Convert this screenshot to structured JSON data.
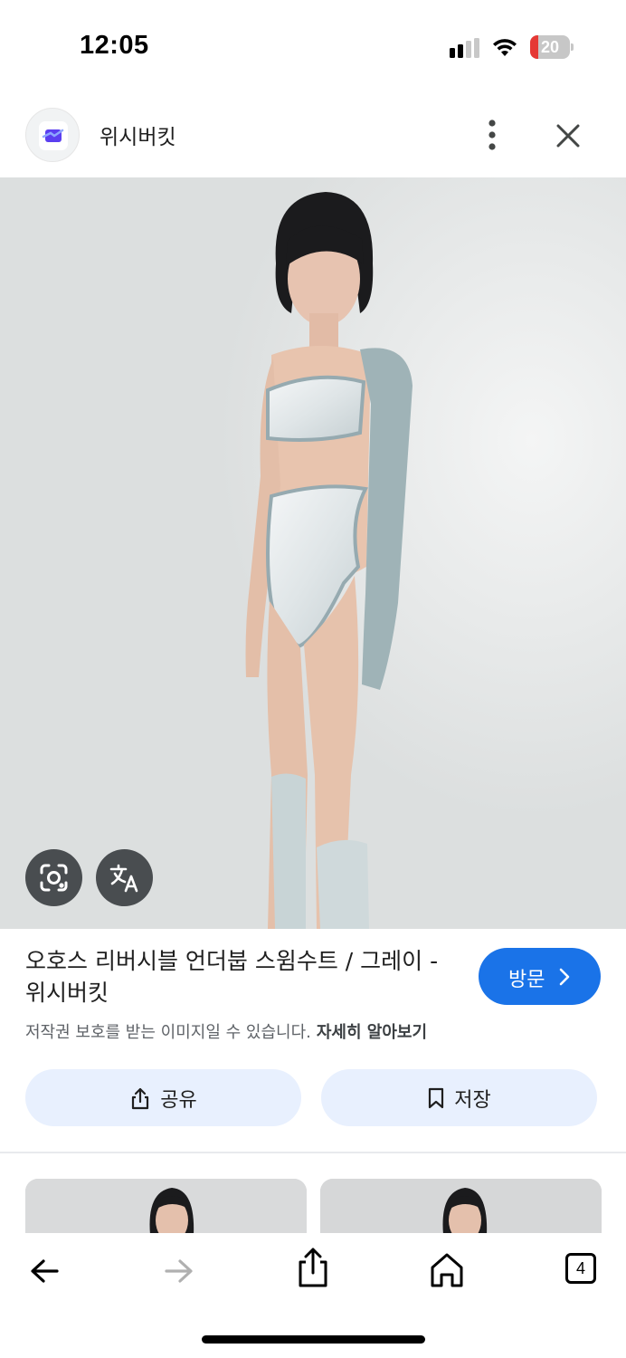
{
  "status_bar": {
    "time": "12:05",
    "battery_text": "20",
    "battery_level_percent": 20,
    "icons": [
      "signal-icon",
      "wifi-icon",
      "battery-icon"
    ]
  },
  "header": {
    "site_name": "위시버킷",
    "icons": [
      "site-logo-icon",
      "more-vert-icon",
      "close-icon"
    ]
  },
  "image": {
    "icons": [
      "lens-icon",
      "translate-icon"
    ]
  },
  "item": {
    "title": "오호스 리버시블 언더붑 스윔수트 / 그레이 - 위시버킷",
    "visit_label": "방문",
    "copyright_notice": "저작권 보호를 받는 이미지일 수 있습니다.",
    "learn_more": "자세히 알아보기"
  },
  "actions": {
    "share_label": "공유",
    "save_label": "저장"
  },
  "toolbar": {
    "tab_count": "4",
    "icons": [
      "back-arrow-icon",
      "forward-arrow-icon",
      "share-icon",
      "home-icon",
      "tabs-icon"
    ]
  },
  "colors": {
    "accent": "#1a73e8",
    "chip_bg": "#e8f0fe",
    "battery_low": "#e53935"
  }
}
